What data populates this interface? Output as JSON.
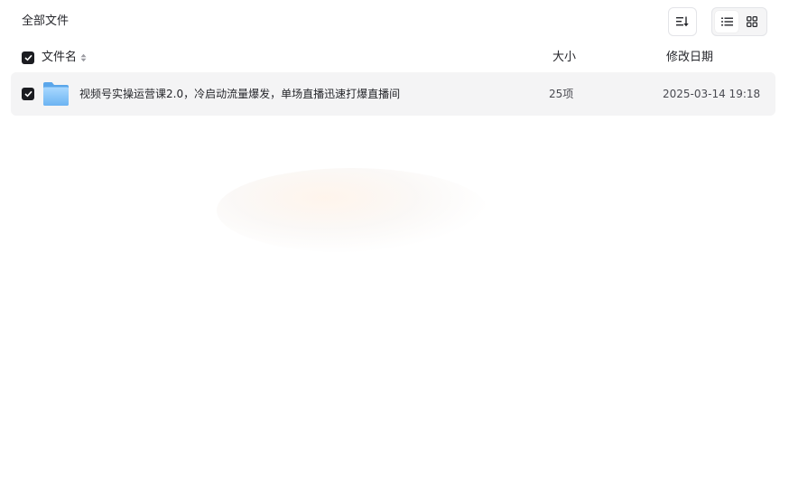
{
  "header": {
    "title": "全部文件",
    "sort_icon": "sort-icon",
    "view_list_icon": "list-view-icon",
    "view_grid_icon": "grid-view-icon",
    "active_view": "list"
  },
  "columns": {
    "name": "文件名",
    "size": "大小",
    "date": "修改日期"
  },
  "files": [
    {
      "name": "视频号实操运营课2.0，冷启动流量爆发，单场直播迅速打爆直播间",
      "size": "25项",
      "date": "2025-03-14 19:18",
      "icon": "folder-icon",
      "selected": true
    }
  ],
  "colors": {
    "text": "#25262b",
    "row_bg": "#f4f4f5",
    "checkbox": "#1b1c21",
    "folder": "#7cc0f7"
  }
}
